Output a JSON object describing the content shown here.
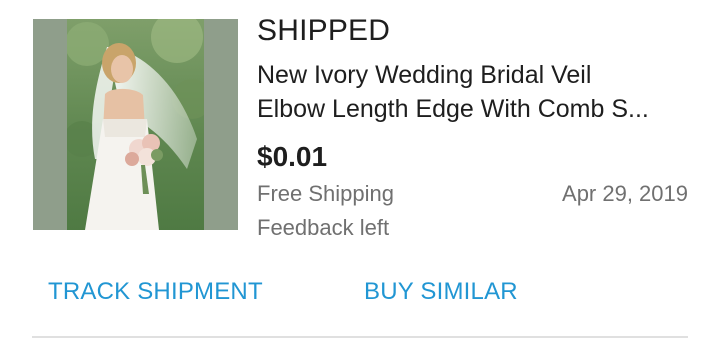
{
  "order": {
    "status": "SHIPPED",
    "title_line1": "New Ivory Wedding Bridal Veil",
    "title_line2": "Elbow Length Edge With Comb S...",
    "price": "$0.01",
    "shipping": "Free Shipping",
    "date": "Apr 29, 2019",
    "feedback": "Feedback left",
    "image": "bride-with-veil-photo"
  },
  "actions": {
    "track": "TRACK SHIPMENT",
    "similar": "BUY SIMILAR"
  },
  "colors": {
    "accent": "#2196d3",
    "secondary_text": "#707070",
    "thumb_bg": "#8f9e8b"
  }
}
